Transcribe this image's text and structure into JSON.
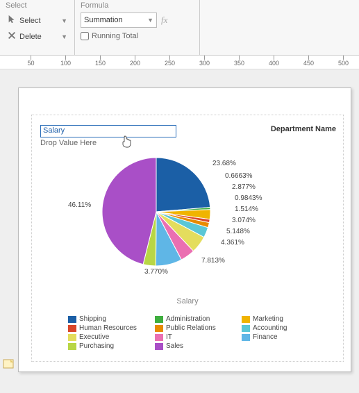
{
  "ribbon": {
    "select_group_title": "Select",
    "select_btn": "Select",
    "delete_btn": "Delete",
    "formula_group_title": "Formula",
    "formula_value": "Summation",
    "fx_label": "fx",
    "running_total_label": "Running Total",
    "running_total_checked": false
  },
  "ruler": {
    "ticks": [
      50,
      100,
      150,
      200,
      250,
      300,
      350,
      400,
      450,
      500
    ]
  },
  "report": {
    "field_value": "Salary",
    "drop_hint": "Drop Value Here",
    "right_title": "Department Name",
    "x_title": "Salary"
  },
  "chart_data": {
    "type": "pie",
    "title": "Salary",
    "legend_title": "Department Name",
    "series": [
      {
        "name": "Shipping",
        "value": 23.68,
        "label": "23.68%",
        "color": "#1b5fa6"
      },
      {
        "name": "Administration",
        "value": 0.6663,
        "label": "0.6663%",
        "color": "#3fae3f"
      },
      {
        "name": "Marketing",
        "value": 2.877,
        "label": "2.877%",
        "color": "#f0b400"
      },
      {
        "name": "Human Resources",
        "value": 0.9843,
        "label": "0.9843%",
        "color": "#d9462a"
      },
      {
        "name": "Public Relations",
        "value": 1.514,
        "label": "1.514%",
        "color": "#e88b00"
      },
      {
        "name": "Accounting",
        "value": 3.074,
        "label": "3.074%",
        "color": "#5ac7d6"
      },
      {
        "name": "Executive",
        "value": 5.148,
        "label": "5.148%",
        "color": "#e4dd5d"
      },
      {
        "name": "IT",
        "value": 4.361,
        "label": "4.361%",
        "color": "#ea6fb2"
      },
      {
        "name": "Finance",
        "value": 7.813,
        "label": "7.813%",
        "color": "#5fb6e6"
      },
      {
        "name": "Purchasing",
        "value": 3.77,
        "label": "3.770%",
        "color": "#b8d645"
      },
      {
        "name": "Sales",
        "value": 46.11,
        "label": "46.11%",
        "color": "#a94fc7"
      }
    ],
    "legend_order": [
      "Shipping",
      "Administration",
      "Marketing",
      "Human Resources",
      "Public Relations",
      "Accounting",
      "Executive",
      "IT",
      "Finance",
      "Purchasing",
      "Sales"
    ]
  },
  "labels": {
    "l0": "23.68%",
    "l1": "0.6663%",
    "l2": "2.877%",
    "l3": "0.9843%",
    "l4": "1.514%",
    "l5": "3.074%",
    "l6": "5.148%",
    "l7": "4.361%",
    "l8": "7.813%",
    "l9": "3.770%",
    "l10": "46.11%"
  }
}
